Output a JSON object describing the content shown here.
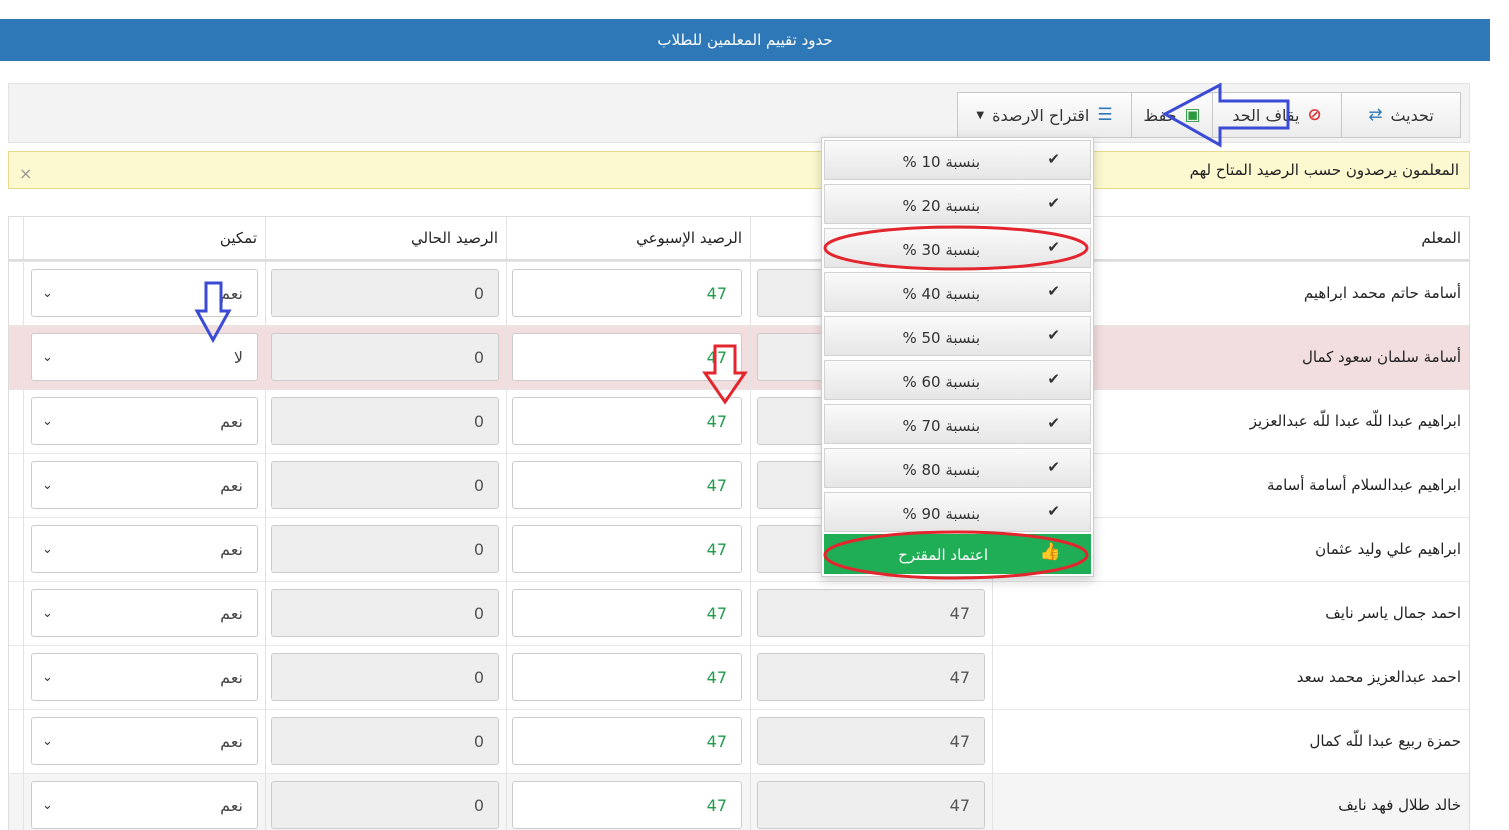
{
  "title": "حدود تقييم المعلمين للطلاب",
  "toolbar": {
    "refresh_label": "تحديث",
    "stop_label": "يقاف الحد",
    "save_label": "حفظ",
    "suggest_label": "اقتراح الارصدة"
  },
  "alert": {
    "text": "المعلمون يرصدون حسب الرصيد المتاح لهم",
    "close": "×"
  },
  "table": {
    "headers": {
      "teacher": "المعلم",
      "weekly": "الرصيد الإسبوعي",
      "current": "الرصيد الحالي",
      "enable": "تمكين"
    },
    "rows": [
      {
        "name": "أسامة حاتم محمد ابراهيم",
        "col2": "",
        "weekly": "47",
        "current": "0",
        "enable": "نعم"
      },
      {
        "name": "أسامة سلمان سعود كمال",
        "col2": "",
        "weekly": "47",
        "current": "0",
        "enable": "لا"
      },
      {
        "name": "ابراهيم عبدا للّه عبدا للّه عبدالعزيز",
        "col2": "",
        "weekly": "47",
        "current": "0",
        "enable": "نعم"
      },
      {
        "name": "ابراهيم عبدالسلام أسامة أسامة",
        "col2": "",
        "weekly": "47",
        "current": "0",
        "enable": "نعم"
      },
      {
        "name": "ابراهيم علي وليد عثمان",
        "col2": "",
        "weekly": "47",
        "current": "0",
        "enable": "نعم"
      },
      {
        "name": "احمد جمال ياسر نايف",
        "col2": "47",
        "weekly": "47",
        "current": "0",
        "enable": "نعم"
      },
      {
        "name": "احمد عبدالعزيز محمد سعد",
        "col2": "47",
        "weekly": "47",
        "current": "0",
        "enable": "نعم"
      },
      {
        "name": "حمزة ربيع عبدا للّه كمال",
        "col2": "47",
        "weekly": "47",
        "current": "0",
        "enable": "نعم"
      },
      {
        "name": "خالد طلال فهد نايف",
        "col2": "47",
        "weekly": "47",
        "current": "0",
        "enable": "نعم"
      }
    ]
  },
  "menu": {
    "items": [
      {
        "label": "بنسبة 10 %"
      },
      {
        "label": "بنسبة 20 %"
      },
      {
        "label": "بنسبة 30 %"
      },
      {
        "label": "بنسبة 40 %"
      },
      {
        "label": "بنسبة 50 %"
      },
      {
        "label": "بنسبة 60 %"
      },
      {
        "label": "بنسبة 70 %"
      },
      {
        "label": "بنسبة 80 %"
      },
      {
        "label": "بنسبة 90 %"
      }
    ],
    "approve_label": "اعتماد المقترح"
  },
  "colors": {
    "header_blue": "#2f78b7",
    "accent_green": "#1fae55",
    "value_green": "#1f9e4c",
    "danger_row": "#f2dede",
    "alert_bg": "#fcf8cf",
    "annotation_red": "#e3262e",
    "annotation_blue": "#3b4bd6"
  }
}
